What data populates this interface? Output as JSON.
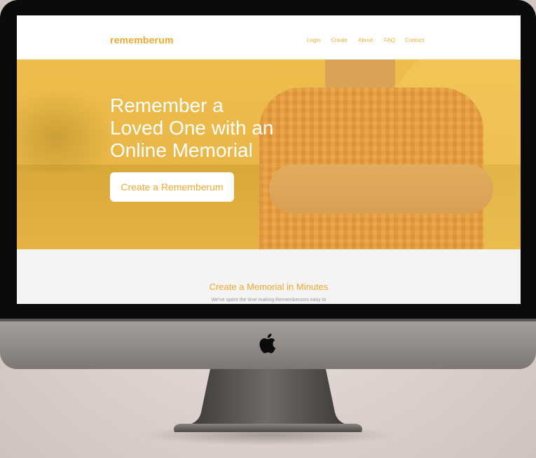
{
  "site": {
    "brand": "rememberum",
    "nav": [
      "Login",
      "Create",
      "About",
      "FAQ",
      "Contact"
    ]
  },
  "hero": {
    "title_lines": [
      "Remember a",
      "Loved One with an",
      "Online Memorial"
    ],
    "cta_label": "Create a Rememberum"
  },
  "section": {
    "title": "Create a Memorial in Minutes",
    "subtitle": "We've spent the time making Rememberums easy to"
  },
  "icons": {
    "device_logo": "apple-logo-icon"
  },
  "colors": {
    "accent": "#f0a92c",
    "hero_overlay": "#e9b845",
    "bezel": "#0b0b0b",
    "chin": "#8f8986"
  }
}
